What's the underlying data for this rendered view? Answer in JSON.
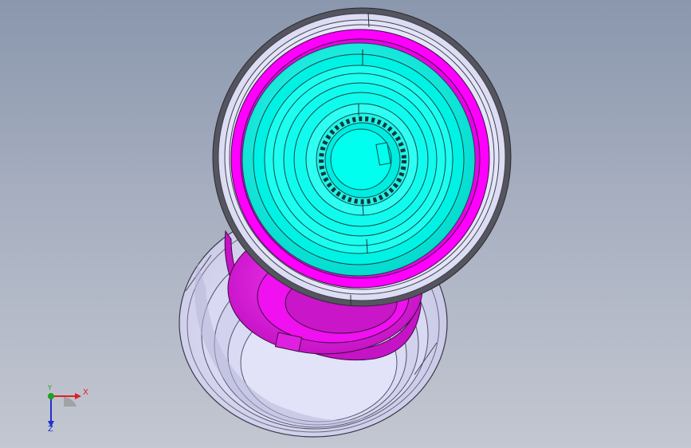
{
  "viewport": {
    "background_top": "#8a97ad",
    "background_bottom": "#c3c7d1"
  },
  "model": {
    "parts": [
      {
        "name": "rear-shell",
        "color": "#ddddf5"
      },
      {
        "name": "rear-magenta-ring",
        "color": "#e01fe0"
      },
      {
        "name": "front-outer-rim",
        "color": "#55555f"
      },
      {
        "name": "front-magenta-band",
        "color": "#ff00ff"
      },
      {
        "name": "front-cyan-body",
        "color": "#00ffee"
      },
      {
        "name": "gear-hub",
        "color": "#00e8e0"
      }
    ]
  },
  "triad": {
    "x_label": "X",
    "y_label": "Y",
    "z_label": "Z",
    "x_color": "#e02020",
    "y_color": "#20a020",
    "z_color": "#2030d0"
  }
}
